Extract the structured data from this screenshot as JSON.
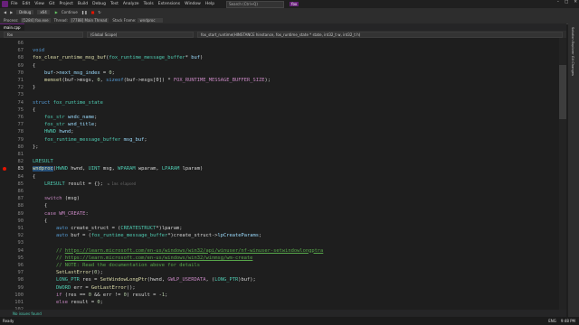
{
  "menu": {
    "items": [
      "File",
      "Edit",
      "View",
      "Git",
      "Project",
      "Build",
      "Debug",
      "Test",
      "Analyze",
      "Tools",
      "Extensions",
      "Window",
      "Help"
    ],
    "search": "Search (Ctrl+Q)",
    "app_badge": "fox"
  },
  "toolbar": {
    "continue_label": "Continue",
    "config": "Debug",
    "platform": "x64"
  },
  "debug_bar": {
    "process_label": "Process:",
    "process_value": "[5284] fox.exe",
    "thread_label": "Thread:",
    "thread_value": "[7788] Main Thread",
    "frame_label": "Stack Frame:",
    "frame_value": "wndproc"
  },
  "tab": {
    "file": "main.cpp"
  },
  "nav": {
    "project": "fox",
    "scope": "(Global Scope)",
    "member": "fox_start_runtime(HINSTANCE hinstance, fox_runtime_state * state, int32_t w, int32_t h)"
  },
  "right_panel": {
    "label": "Solution Explorer   Git Changes"
  },
  "status": {
    "issues": "No issues found",
    "mode": "Ready",
    "time": "9:48 PM",
    "lang": "ENG"
  },
  "code_lines": [
    {
      "n": "66",
      "segs": []
    },
    {
      "n": "67",
      "segs": [
        [
          "k",
          "void"
        ]
      ]
    },
    {
      "n": "68",
      "segs": [
        [
          "f",
          "fox_clear_runtime_msg_buf"
        ],
        [
          "d",
          "("
        ],
        [
          "t",
          "fox_runtime_message_buffer"
        ],
        [
          "d",
          "* "
        ],
        [
          "p",
          "buf"
        ],
        [
          "d",
          ")"
        ]
      ]
    },
    {
      "n": "69",
      "segs": [
        [
          "d",
          "{"
        ]
      ]
    },
    {
      "n": "70",
      "segs": [
        [
          "d",
          "    "
        ],
        [
          "p",
          "buf"
        ],
        [
          "d",
          "->"
        ],
        [
          "p",
          "next_msg_index"
        ],
        [
          "d",
          " = "
        ],
        [
          "n",
          "0"
        ],
        [
          "d",
          ";"
        ]
      ]
    },
    {
      "n": "71",
      "segs": [
        [
          "d",
          "    "
        ],
        [
          "f",
          "memset"
        ],
        [
          "d",
          "(buf->msgs, "
        ],
        [
          "n",
          "0"
        ],
        [
          "d",
          ", "
        ],
        [
          "k",
          "sizeof"
        ],
        [
          "d",
          "(buf->msgs[0]) * "
        ],
        [
          "m",
          "FOX_RUNTIME_MESSAGE_BUFFER_SIZE"
        ],
        [
          "d",
          ");"
        ]
      ]
    },
    {
      "n": "72",
      "segs": [
        [
          "d",
          "}"
        ]
      ]
    },
    {
      "n": "73",
      "segs": []
    },
    {
      "n": "74",
      "segs": [
        [
          "k",
          "struct "
        ],
        [
          "t",
          "fox_runtime_state"
        ]
      ]
    },
    {
      "n": "75",
      "segs": [
        [
          "d",
          "{"
        ]
      ]
    },
    {
      "n": "76",
      "segs": [
        [
          "d",
          "    "
        ],
        [
          "t",
          "fox_str"
        ],
        [
          "d",
          " "
        ],
        [
          "p",
          "wndc_name"
        ],
        [
          "d",
          ";"
        ]
      ]
    },
    {
      "n": "77",
      "segs": [
        [
          "d",
          "    "
        ],
        [
          "t",
          "fox_str"
        ],
        [
          "d",
          " "
        ],
        [
          "p",
          "wnd_title"
        ],
        [
          "d",
          ";"
        ]
      ]
    },
    {
      "n": "78",
      "segs": [
        [
          "d",
          "    "
        ],
        [
          "t",
          "HWND"
        ],
        [
          "d",
          " "
        ],
        [
          "p",
          "hwnd"
        ],
        [
          "d",
          ";"
        ]
      ]
    },
    {
      "n": "79",
      "segs": [
        [
          "d",
          "    "
        ],
        [
          "t",
          "fox_runtime_message_buffer"
        ],
        [
          "d",
          " "
        ],
        [
          "p",
          "msg_buf"
        ],
        [
          "d",
          ";"
        ]
      ]
    },
    {
      "n": "80",
      "segs": [
        [
          "d",
          "};"
        ]
      ]
    },
    {
      "n": "81",
      "segs": []
    },
    {
      "n": "82",
      "segs": [
        [
          "t",
          "LRESULT"
        ]
      ]
    },
    {
      "n": "83",
      "segs": [
        [
          "f",
          "wndproc"
        ],
        [
          "d",
          "("
        ],
        [
          "t",
          "HWND"
        ],
        [
          "d",
          " hwnd, "
        ],
        [
          "t",
          "UINT"
        ],
        [
          "d",
          " msg, "
        ],
        [
          "t",
          "WPARAM"
        ],
        [
          "d",
          " wparam, "
        ],
        [
          "t",
          "LPARAM"
        ],
        [
          "d",
          " lparam)"
        ]
      ],
      "bp": true,
      "cur": true
    },
    {
      "n": "84",
      "segs": [
        [
          "d",
          "{"
        ]
      ]
    },
    {
      "n": "85",
      "segs": [
        [
          "d",
          "    "
        ],
        [
          "t",
          "LRESULT"
        ],
        [
          "d",
          " result = {};"
        ],
        [
          "hint",
          "  ≤ 1ms elapsed"
        ]
      ]
    },
    {
      "n": "86",
      "segs": []
    },
    {
      "n": "87",
      "segs": [
        [
          "d",
          "    "
        ],
        [
          "m",
          "switch"
        ],
        [
          "d",
          " (msg)"
        ]
      ]
    },
    {
      "n": "88",
      "segs": [
        [
          "d",
          "    {"
        ]
      ]
    },
    {
      "n": "89",
      "segs": [
        [
          "d",
          "    "
        ],
        [
          "m",
          "case"
        ],
        [
          "d",
          " "
        ],
        [
          "m",
          "WM_CREATE"
        ],
        [
          "d",
          ":"
        ]
      ]
    },
    {
      "n": "90",
      "segs": [
        [
          "d",
          "    {"
        ]
      ]
    },
    {
      "n": "91",
      "segs": [
        [
          "d",
          "        "
        ],
        [
          "k",
          "auto"
        ],
        [
          "d",
          " create_struct = ("
        ],
        [
          "t",
          "CREATESTRUCT"
        ],
        [
          "d",
          "*)lparam;"
        ]
      ]
    },
    {
      "n": "92",
      "segs": [
        [
          "d",
          "        "
        ],
        [
          "k",
          "auto"
        ],
        [
          "d",
          " buf = ("
        ],
        [
          "t",
          "fox_runtime_message_buffer"
        ],
        [
          "d",
          "*)create_struct->"
        ],
        [
          "p",
          "lpCreateParams"
        ],
        [
          "d",
          ";"
        ]
      ]
    },
    {
      "n": "93",
      "segs": []
    },
    {
      "n": "94",
      "segs": [
        [
          "c",
          "        // "
        ],
        [
          "u",
          "https://learn.microsoft.com/en-us/windows/win32/api/winuser/nf-winuser-setwindowlongptra"
        ]
      ]
    },
    {
      "n": "95",
      "segs": [
        [
          "c",
          "        // "
        ],
        [
          "u",
          "https://learn.microsoft.com/en-us/windows/win32/winmsg/wm-create"
        ]
      ]
    },
    {
      "n": "96",
      "segs": [
        [
          "c",
          "        // NOTE: Read the documentation above for details"
        ]
      ]
    },
    {
      "n": "97",
      "segs": [
        [
          "d",
          "        "
        ],
        [
          "f",
          "SetLastError"
        ],
        [
          "d",
          "("
        ],
        [
          "n",
          "0"
        ],
        [
          "d",
          ");"
        ]
      ]
    },
    {
      "n": "98",
      "segs": [
        [
          "d",
          "        "
        ],
        [
          "t",
          "LONG_PTR"
        ],
        [
          "d",
          " res = "
        ],
        [
          "f",
          "SetWindowLongPtr"
        ],
        [
          "d",
          "(hwnd, "
        ],
        [
          "m",
          "GWLP_USERDATA"
        ],
        [
          "d",
          ", ("
        ],
        [
          "t",
          "LONG_PTR"
        ],
        [
          "d",
          ")buf);"
        ]
      ]
    },
    {
      "n": "99",
      "segs": [
        [
          "d",
          "        "
        ],
        [
          "t",
          "DWORD"
        ],
        [
          "d",
          " err = "
        ],
        [
          "f",
          "GetLastError"
        ],
        [
          "d",
          "();"
        ]
      ]
    },
    {
      "n": "100",
      "segs": [
        [
          "d",
          "        "
        ],
        [
          "m",
          "if"
        ],
        [
          "d",
          " (res == "
        ],
        [
          "n",
          "0"
        ],
        [
          "d",
          " && err != "
        ],
        [
          "n",
          "0"
        ],
        [
          "d",
          ") result = -"
        ],
        [
          "n",
          "1"
        ],
        [
          "d",
          ";"
        ]
      ]
    },
    {
      "n": "101",
      "segs": [
        [
          "d",
          "        "
        ],
        [
          "m",
          "else"
        ],
        [
          "d",
          " result = "
        ],
        [
          "n",
          "0"
        ],
        [
          "d",
          ";"
        ]
      ]
    },
    {
      "n": "102",
      "segs": []
    },
    {
      "n": "103",
      "segs": [
        [
          "d",
          "    } "
        ],
        [
          "m",
          "break"
        ],
        [
          "d",
          ";"
        ]
      ]
    }
  ]
}
